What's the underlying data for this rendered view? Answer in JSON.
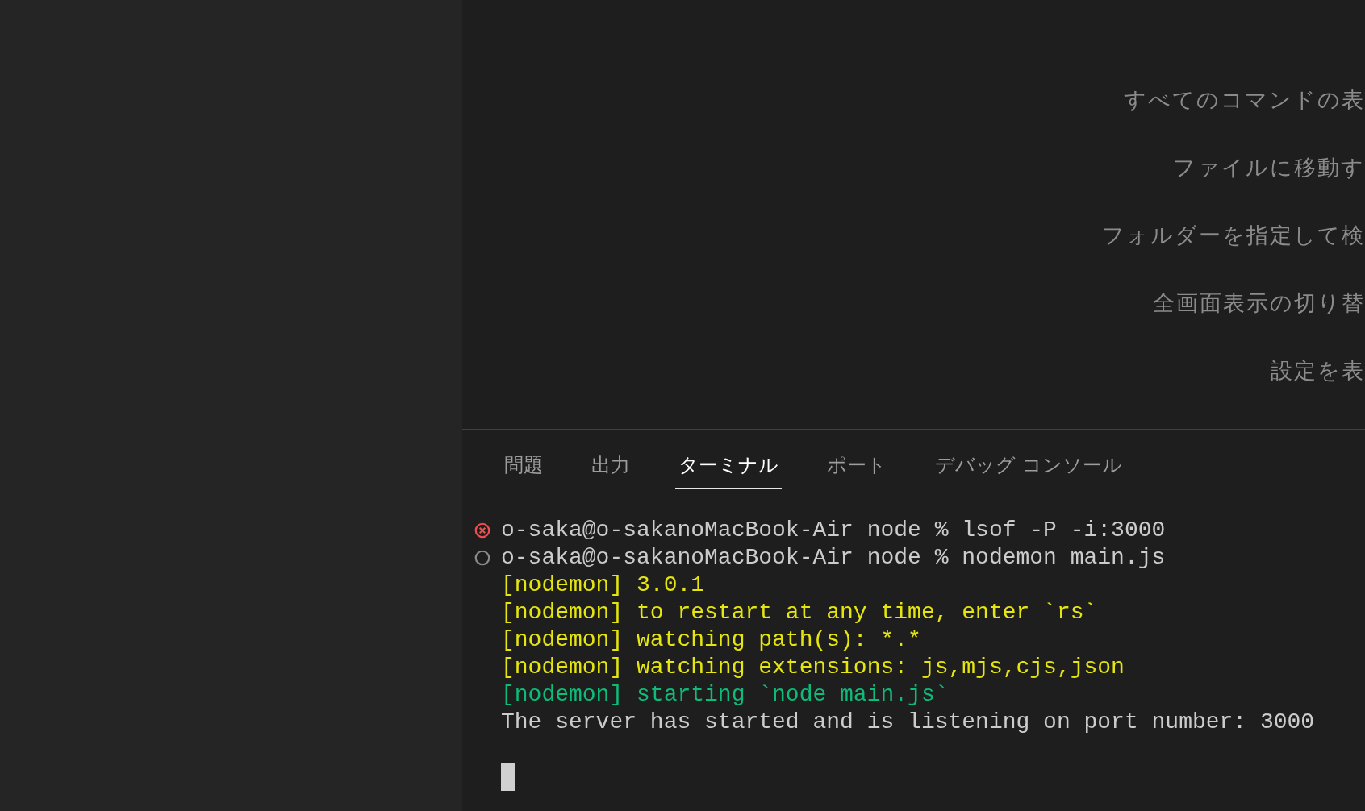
{
  "welcome_shortcuts": [
    {
      "label": "すべてのコマンドの表"
    },
    {
      "label": "ファイルに移動す"
    },
    {
      "label": "フォルダーを指定して検"
    },
    {
      "label": "全画面表示の切り替"
    },
    {
      "label": "設定を表"
    }
  ],
  "panel": {
    "tabs": [
      {
        "label": "問題",
        "selected": false
      },
      {
        "label": "出力",
        "selected": false
      },
      {
        "label": "ターミナル",
        "selected": true
      },
      {
        "label": "ポート",
        "selected": false
      },
      {
        "label": "デバッグ コンソール",
        "selected": false
      }
    ],
    "terminal_lines": [
      {
        "kind": "command",
        "failed": true,
        "text": "o-saka@o-sakanoMacBook-Air node % lsof -P -i:3000"
      },
      {
        "kind": "command",
        "failed": false,
        "text": "o-saka@o-sakanoMacBook-Air node % nodemon main.js"
      },
      {
        "kind": "output",
        "color": "#e5e510",
        "text": "[nodemon] 3.0.1"
      },
      {
        "kind": "output",
        "color": "#e5e510",
        "text": "[nodemon] to restart at any time, enter `rs`"
      },
      {
        "kind": "output",
        "color": "#e5e510",
        "text": "[nodemon] watching path(s): *.*"
      },
      {
        "kind": "output",
        "color": "#e5e510",
        "text": "[nodemon] watching extensions: js,mjs,cjs,json"
      },
      {
        "kind": "output",
        "color": "#0dbc79",
        "text": "[nodemon] starting `node main.js`"
      },
      {
        "kind": "output",
        "color": "#cccccc",
        "text": "The server has started and is listening on port number: 3000"
      },
      {
        "kind": "cursor"
      }
    ]
  }
}
